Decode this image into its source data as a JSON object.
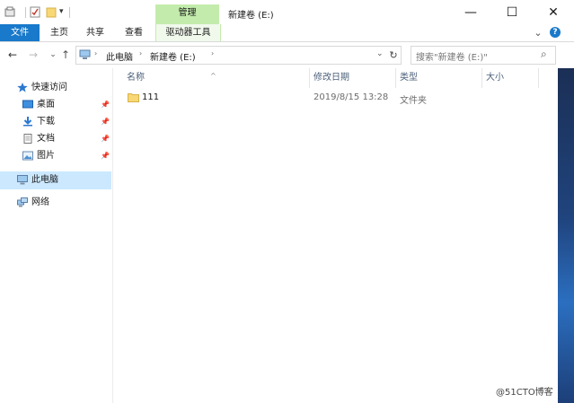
{
  "window": {
    "context_tab_header": "管理",
    "title": "新建卷 (E:)",
    "minimize": "—",
    "maximize": "☐",
    "close": "✕"
  },
  "ribbon": {
    "tabs": [
      "文件",
      "主页",
      "共享",
      "查看",
      "驱动器工具"
    ],
    "help": "?",
    "expand": "⌄"
  },
  "address": {
    "back": "←",
    "forward": "→",
    "recent": "⌄",
    "up": "↑",
    "breadcrumb": [
      "此电脑",
      "新建卷 (E:)"
    ],
    "separator": "›",
    "dropdown": "⌄",
    "refresh": "↻",
    "search_placeholder": "搜索\"新建卷 (E:)\"",
    "search_icon": "⌕"
  },
  "nav": {
    "quick_access": "快速访问",
    "items": [
      {
        "label": "桌面",
        "icon": "desktop-icon",
        "pinned": true
      },
      {
        "label": "下载",
        "icon": "download-icon",
        "pinned": true
      },
      {
        "label": "文档",
        "icon": "documents-icon",
        "pinned": true
      },
      {
        "label": "图片",
        "icon": "pictures-icon",
        "pinned": true
      }
    ],
    "this_pc": "此电脑",
    "network": "网络",
    "pin_glyph": "📌"
  },
  "columns": {
    "name": "名称",
    "date": "修改日期",
    "type": "类型",
    "size": "大小",
    "sort_glyph": "^"
  },
  "files": [
    {
      "name": "111",
      "date": "2019/8/15 13:28",
      "type": "文件夹",
      "size": ""
    }
  ],
  "watermark": "@51CTO博客",
  "colors": {
    "file_tab": "#1979ca",
    "context_tab": "#c3ecac",
    "selected_nav": "#cce8ff",
    "folder": "#f8d775"
  }
}
